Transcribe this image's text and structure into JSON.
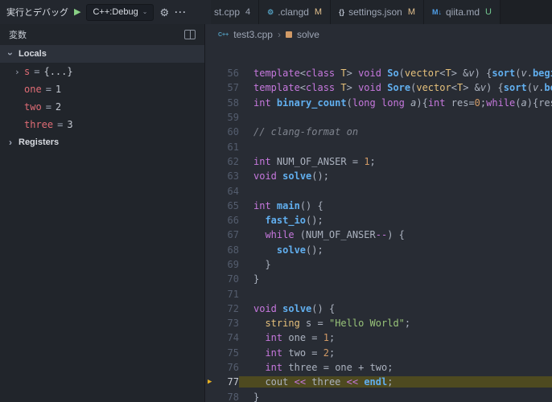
{
  "debug_toolbar": {
    "view_title": "実行とデバッグ",
    "play_icon": "▶",
    "start_label": "C++:Debug",
    "dropdown_chevron": "⌄",
    "gear_icon": "⚙",
    "more_icon": "···"
  },
  "tabs": [
    {
      "label": "st.cpp",
      "badge": "4",
      "badge_color": "#9da5b4",
      "icon_name": "cpp-file-icon",
      "icon_glyph": "",
      "icon_color": "#519aba",
      "partial": true
    },
    {
      "label": ".clangd",
      "badge": "M",
      "badge_color": "#e2c08d",
      "icon_name": "clangd-file-icon",
      "icon_glyph": "⚙",
      "icon_color": "#519aba",
      "partial": false
    },
    {
      "label": "settings.json",
      "badge": "M",
      "badge_color": "#e2c08d",
      "icon_name": "json-settings-file-icon",
      "icon_glyph": "{}",
      "icon_color": "#b8bfcc",
      "partial": false
    },
    {
      "label": "qiita.md",
      "badge": "U",
      "badge_color": "#73c991",
      "icon_name": "markdown-file-icon",
      "icon_glyph": "M↓",
      "icon_color": "#4f9fe8",
      "partial": false
    }
  ],
  "sidebar": {
    "panel_title": "変数",
    "sections": [
      {
        "label": "Locals",
        "expanded": true,
        "variables": [
          {
            "name": "s",
            "value": "{...}",
            "expandable": true
          },
          {
            "name": "one",
            "value": "1",
            "expandable": false
          },
          {
            "name": "two",
            "value": "2",
            "expandable": false
          },
          {
            "name": "three",
            "value": "3",
            "expandable": false
          }
        ]
      },
      {
        "label": "Registers",
        "expanded": false,
        "variables": []
      }
    ]
  },
  "breadcrumb": {
    "file_icon_glyph": "C++",
    "file": "test3.cpp",
    "separator": "›",
    "symbol": "solve"
  },
  "editor": {
    "current_line": 77,
    "lines": [
      {
        "num": 56,
        "segments": [
          [
            "template",
            "kw"
          ],
          [
            "<",
            "p"
          ],
          [
            "class",
            "kw"
          ],
          [
            " ",
            "p"
          ],
          [
            "T",
            "type"
          ],
          [
            "> ",
            "p"
          ],
          [
            "void",
            "kw"
          ],
          [
            " ",
            "p"
          ],
          [
            "So",
            "fn"
          ],
          [
            "(",
            "p"
          ],
          [
            "vector",
            "type"
          ],
          [
            "<",
            "p"
          ],
          [
            "T",
            "type"
          ],
          [
            "> &",
            "p"
          ],
          [
            "v",
            "param"
          ],
          [
            ") {",
            "p"
          ],
          [
            "sort",
            "fn"
          ],
          [
            "(",
            "p"
          ],
          [
            "v",
            "param"
          ],
          [
            ".",
            "p"
          ],
          [
            "begi",
            "fn"
          ]
        ]
      },
      {
        "num": 57,
        "segments": [
          [
            "template",
            "kw"
          ],
          [
            "<",
            "p"
          ],
          [
            "class",
            "kw"
          ],
          [
            " ",
            "p"
          ],
          [
            "T",
            "type"
          ],
          [
            "> ",
            "p"
          ],
          [
            "void",
            "kw"
          ],
          [
            " ",
            "p"
          ],
          [
            "Sore",
            "fn"
          ],
          [
            "(",
            "p"
          ],
          [
            "vector",
            "type"
          ],
          [
            "<",
            "p"
          ],
          [
            "T",
            "type"
          ],
          [
            "> &",
            "p"
          ],
          [
            "v",
            "param"
          ],
          [
            ") {",
            "p"
          ],
          [
            "sort",
            "fn"
          ],
          [
            "(",
            "p"
          ],
          [
            "v",
            "param"
          ],
          [
            ".",
            "p"
          ],
          [
            "be",
            "fn"
          ]
        ]
      },
      {
        "num": 58,
        "segments": [
          [
            "int",
            "kw"
          ],
          [
            " ",
            "p"
          ],
          [
            "binary_count",
            "fn"
          ],
          [
            "(",
            "p"
          ],
          [
            "long",
            "kw"
          ],
          [
            " ",
            "p"
          ],
          [
            "long",
            "kw"
          ],
          [
            " ",
            "p"
          ],
          [
            "a",
            "param"
          ],
          [
            "){",
            "p"
          ],
          [
            "int",
            "kw"
          ],
          [
            " ",
            "p"
          ],
          [
            "res",
            "p"
          ],
          [
            "=",
            "p"
          ],
          [
            "0",
            "num"
          ],
          [
            ";",
            "p"
          ],
          [
            "while",
            "kw"
          ],
          [
            "(",
            "p"
          ],
          [
            "a",
            "param"
          ],
          [
            "){",
            "p"
          ],
          [
            "res",
            "p"
          ]
        ]
      },
      {
        "num": 59,
        "segments": []
      },
      {
        "num": 60,
        "segments": [
          [
            "// clang-format on",
            "cm"
          ]
        ]
      },
      {
        "num": 61,
        "segments": []
      },
      {
        "num": 62,
        "segments": [
          [
            "int",
            "kw"
          ],
          [
            " ",
            "p"
          ],
          [
            "NUM_OF_ANSER",
            "p"
          ],
          [
            " = ",
            "p"
          ],
          [
            "1",
            "num"
          ],
          [
            ";",
            "p"
          ]
        ]
      },
      {
        "num": 63,
        "segments": [
          [
            "void",
            "kw"
          ],
          [
            " ",
            "p"
          ],
          [
            "solve",
            "fn"
          ],
          [
            "();",
            "p"
          ]
        ]
      },
      {
        "num": 64,
        "segments": []
      },
      {
        "num": 65,
        "segments": [
          [
            "int",
            "kw"
          ],
          [
            " ",
            "p"
          ],
          [
            "main",
            "fn"
          ],
          [
            "() {",
            "p"
          ]
        ]
      },
      {
        "num": 66,
        "segments": [
          [
            "  ",
            "p"
          ],
          [
            "fast_io",
            "fn"
          ],
          [
            "();",
            "p"
          ]
        ]
      },
      {
        "num": 67,
        "segments": [
          [
            "  ",
            "p"
          ],
          [
            "while",
            "kw"
          ],
          [
            " (",
            "p"
          ],
          [
            "NUM_OF_ANSER",
            "p"
          ],
          [
            "--",
            "op"
          ],
          [
            ") {",
            "p"
          ]
        ]
      },
      {
        "num": 68,
        "segments": [
          [
            "    ",
            "p"
          ],
          [
            "solve",
            "fn"
          ],
          [
            "();",
            "p"
          ]
        ]
      },
      {
        "num": 69,
        "segments": [
          [
            "  }",
            "p"
          ]
        ]
      },
      {
        "num": 70,
        "segments": [
          [
            "}",
            "p"
          ]
        ]
      },
      {
        "num": 71,
        "segments": []
      },
      {
        "num": 72,
        "segments": [
          [
            "void",
            "kw"
          ],
          [
            " ",
            "p"
          ],
          [
            "solve",
            "fn"
          ],
          [
            "() {",
            "p"
          ]
        ]
      },
      {
        "num": 73,
        "segments": [
          [
            "  ",
            "p"
          ],
          [
            "string",
            "type"
          ],
          [
            " ",
            "p"
          ],
          [
            "s",
            "p"
          ],
          [
            " = ",
            "p"
          ],
          [
            "\"Hello World\"",
            "str"
          ],
          [
            ";",
            "p"
          ]
        ]
      },
      {
        "num": 74,
        "segments": [
          [
            "  ",
            "p"
          ],
          [
            "int",
            "kw"
          ],
          [
            " ",
            "p"
          ],
          [
            "one",
            "p"
          ],
          [
            " = ",
            "p"
          ],
          [
            "1",
            "num"
          ],
          [
            ";",
            "p"
          ]
        ]
      },
      {
        "num": 75,
        "segments": [
          [
            "  ",
            "p"
          ],
          [
            "int",
            "kw"
          ],
          [
            " ",
            "p"
          ],
          [
            "two",
            "p"
          ],
          [
            " = ",
            "p"
          ],
          [
            "2",
            "num"
          ],
          [
            ";",
            "p"
          ]
        ]
      },
      {
        "num": 76,
        "segments": [
          [
            "  ",
            "p"
          ],
          [
            "int",
            "kw"
          ],
          [
            " ",
            "p"
          ],
          [
            "three",
            "p"
          ],
          [
            " = ",
            "p"
          ],
          [
            "one",
            "p"
          ],
          [
            " + ",
            "p"
          ],
          [
            "two",
            "p"
          ],
          [
            ";",
            "p"
          ]
        ]
      },
      {
        "num": 77,
        "segments": [
          [
            "  ",
            "p"
          ],
          [
            "cout",
            "p"
          ],
          [
            " ",
            "p"
          ],
          [
            "<<",
            "op"
          ],
          [
            " ",
            "p"
          ],
          [
            "three",
            "p"
          ],
          [
            " ",
            "p"
          ],
          [
            "<<",
            "op"
          ],
          [
            " ",
            "p"
          ],
          [
            "endl",
            "fn"
          ],
          [
            ";",
            "p"
          ]
        ]
      },
      {
        "num": 78,
        "segments": [
          [
            "}",
            "p"
          ]
        ]
      }
    ]
  },
  "colors": {
    "modified_badge": "#e2c08d",
    "untracked_badge": "#73c991",
    "debug_line_bg": "#4e4a20",
    "debug_arrow": "#e7b123",
    "start_button_green": "#89d185",
    "variable_name": "#e06c75",
    "editor_bg": "#282c34",
    "sidebar_bg": "#21252b"
  }
}
